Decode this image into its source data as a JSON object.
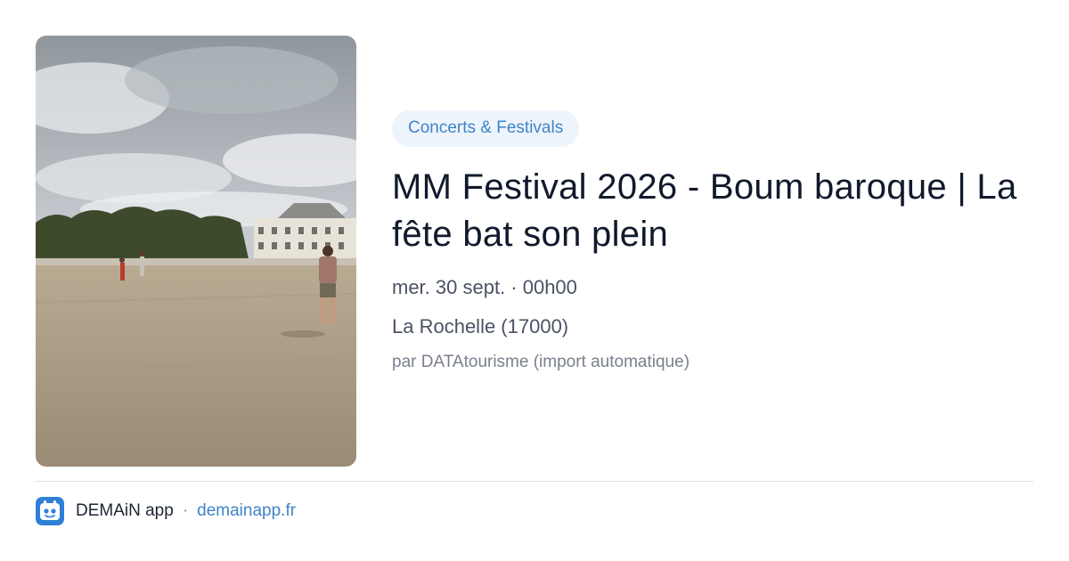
{
  "event": {
    "category": "Concerts & Festivals",
    "title": "MM Festival 2026 - Boum baroque | La fête bat son plein",
    "datetime": "mer. 30 sept. · 00h00",
    "location": "La Rochelle (17000)",
    "source": "par DATAtourisme (import automatique)"
  },
  "footer": {
    "app_name": "DEMAiN app",
    "separator": "·",
    "url": "demainapp.fr"
  },
  "colors": {
    "accent": "#3f84c9",
    "category_bg": "#eef4fb",
    "title": "#111a2c",
    "muted": "#4a5363"
  },
  "icons": {
    "logo": "demain-app-logo-icon"
  }
}
